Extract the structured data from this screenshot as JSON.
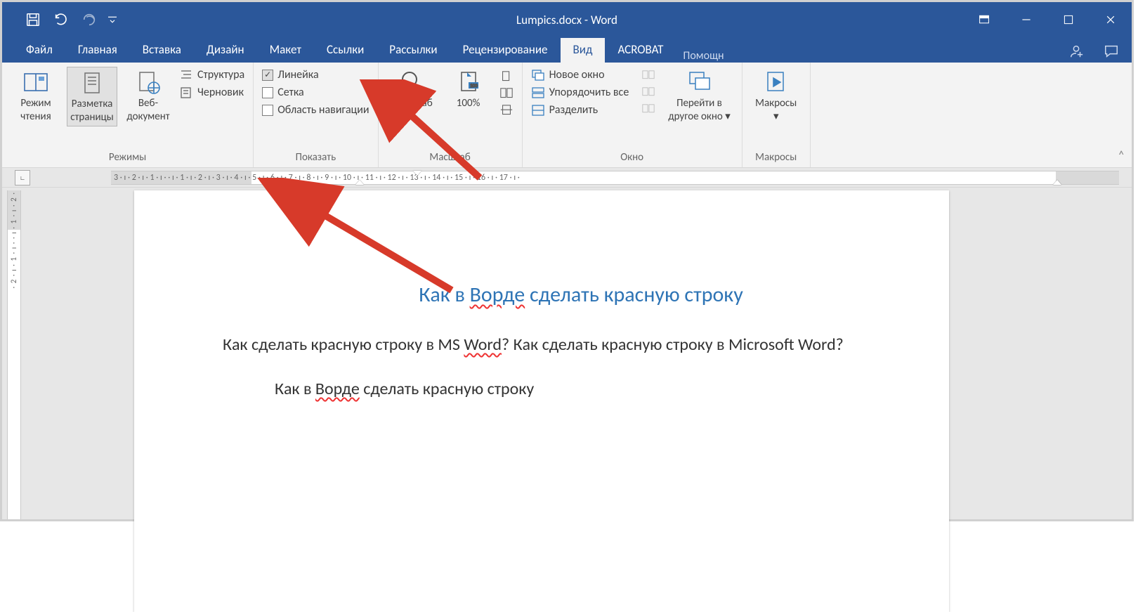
{
  "titlebar": {
    "title": "Lumpics.docx - Word"
  },
  "tabs": {
    "file": "Файл",
    "home": "Главная",
    "insert": "Вставка",
    "design": "Дизайн",
    "layout": "Макет",
    "references": "Ссылки",
    "mailings": "Рассылки",
    "review": "Рецензирование",
    "view": "Вид",
    "acrobat": "ACROBAT",
    "tell_me": "Помощн"
  },
  "ribbon": {
    "views": {
      "label": "Режимы",
      "read_mode_l1": "Режим",
      "read_mode_l2": "чтения",
      "print_layout_l1": "Разметка",
      "print_layout_l2": "страницы",
      "web_layout_l1": "Веб-",
      "web_layout_l2": "документ",
      "outline": "Структура",
      "draft": "Черновик"
    },
    "show": {
      "label": "Показать",
      "ruler": "Линейка",
      "gridlines": "Сетка",
      "navpane": "Область навигации"
    },
    "zoom": {
      "label": "Масштаб",
      "zoom": "Масштаб",
      "hundred": "100%"
    },
    "window": {
      "label": "Окно",
      "new_window": "Новое окно",
      "arrange_all": "Упорядочить все",
      "split": "Разделить",
      "switch_l1": "Перейти в",
      "switch_l2": "другое окно"
    },
    "macros": {
      "label": "Макросы",
      "macros": "Макросы"
    }
  },
  "ruler": {
    "h": "3 · ı · 2 · ı · 1 · ı ·   · ı · 1 · ı · 2 · ı · 3 · ı · 4 · ı · 5 · ı · 6 · ı · 7 · ı · 8 · ı · 9 · ı · 10 · ı · 11 · ı · 12 · ı · 13 · ı · 14 · ı · 15 · ı · 16 · ı · 17 · ı ·",
    "v": "· 2 · ı · 1 · ı ·   · ı · 1 · ı · 2 ·"
  },
  "document": {
    "title_a": "Как в ",
    "title_b": "Ворде",
    "title_c": " сделать красную строку",
    "p1_a": "Как сделать красную строку в MS ",
    "p1_b": "Word",
    "p1_c": "? Как сделать красную строку в Microsoft Word?",
    "p2_a": "Как в ",
    "p2_b": "Ворде",
    "p2_c": " сделать красную строку"
  }
}
